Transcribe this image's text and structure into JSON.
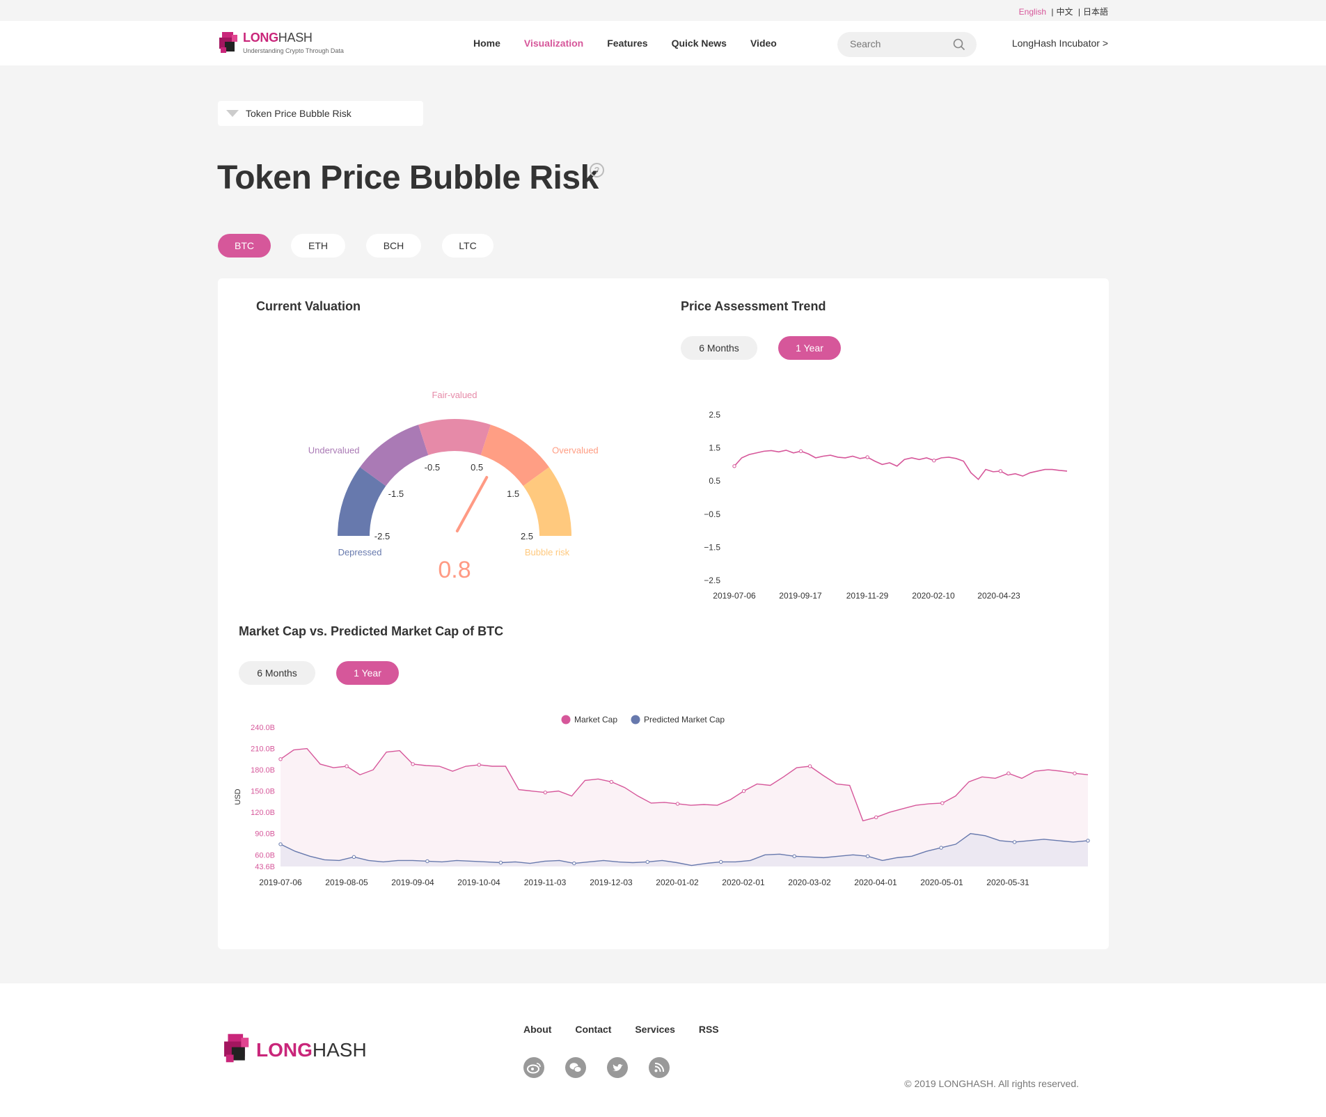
{
  "lang": {
    "english": "English",
    "chinese": "中文",
    "japanese": "日本語",
    "sep": "|"
  },
  "header": {
    "brand_long": "LONG",
    "brand_hash": "HASH",
    "tagline": "Understanding Crypto Through Data",
    "nav": [
      "Home",
      "Visualization",
      "Features",
      "Quick News",
      "Video"
    ],
    "nav_active": "Visualization",
    "search_placeholder": "Search",
    "incubator": "LongHash Incubator >"
  },
  "breadcrumb": {
    "value": "Token Price Bubble Risk"
  },
  "page": {
    "title": "Token Price Bubble Risk",
    "help": "?"
  },
  "coins": {
    "items": [
      "BTC",
      "ETH",
      "BCH",
      "LTC"
    ],
    "active": "BTC"
  },
  "valuation": {
    "title": "Current Valuation",
    "value": 0.8,
    "value_label": "0.8",
    "zones": [
      "Depressed",
      "Undervalued",
      "Fair-valued",
      "Overvalued",
      "Bubble risk"
    ],
    "ticks": [
      "-2.5",
      "-1.5",
      "-0.5",
      "0.5",
      "1.5",
      "2.5"
    ],
    "colors": {
      "depressed": "#6779ad",
      "undervalued": "#aa7ab5",
      "fair": "#e68aa8",
      "overvalued": "#ff9e84",
      "bubble": "#ffc97e",
      "needle": "#ff9a84"
    }
  },
  "trend": {
    "title": "Price Assessment Trend",
    "range_buttons": [
      "6 Months",
      "1 Year"
    ],
    "range_active": "1 Year"
  },
  "market_cap": {
    "title": "Market Cap vs. Predicted Market Cap of BTC",
    "range_buttons": [
      "6 Months",
      "1 Year"
    ],
    "range_active": "1 Year"
  },
  "chart_data": [
    {
      "type": "line",
      "title": "Price Assessment Trend",
      "xlabel": "",
      "ylabel": "",
      "x_ticks": [
        "2019-07-06",
        "2019-09-17",
        "2019-11-29",
        "2020-02-10",
        "2020-04-23"
      ],
      "y_ticks": [
        "2.5",
        "1.5",
        "0.5",
        "−0.5",
        "−1.5",
        "−2.5"
      ],
      "ylim": [
        -2.5,
        2.5
      ],
      "series": [
        {
          "color": "#d6579a",
          "values": [
            0.95,
            1.2,
            1.3,
            1.35,
            1.4,
            1.42,
            1.38,
            1.43,
            1.35,
            1.4,
            1.32,
            1.2,
            1.25,
            1.28,
            1.22,
            1.2,
            1.25,
            1.18,
            1.22,
            1.1,
            1.0,
            1.05,
            0.95,
            1.15,
            1.2,
            1.15,
            1.2,
            1.12,
            1.2,
            1.22,
            1.18,
            1.1,
            0.75,
            0.55,
            0.85,
            0.78,
            0.8,
            0.68,
            0.72,
            0.65,
            0.75,
            0.8,
            0.85,
            0.85,
            0.82,
            0.8
          ]
        }
      ]
    },
    {
      "type": "area",
      "title": "Market Cap vs. Predicted Market Cap of BTC",
      "xlabel": "",
      "ylabel": "USD",
      "x_ticks": [
        "2019-07-06",
        "2019-08-05",
        "2019-09-04",
        "2019-10-04",
        "2019-11-03",
        "2019-12-03",
        "2020-01-02",
        "2020-02-01",
        "2020-03-02",
        "2020-04-01",
        "2020-05-01",
        "2020-05-31"
      ],
      "y_ticks": [
        "240.0B",
        "210.0B",
        "180.0B",
        "150.0B",
        "120.0B",
        "90.0B",
        "60.0B",
        "43.6B"
      ],
      "ylim": [
        43.6,
        240.0
      ],
      "legend": "top-center",
      "series": [
        {
          "name": "Market Cap",
          "color": "#d6579a",
          "values": [
            195,
            208,
            210,
            188,
            183,
            185,
            173,
            180,
            205,
            207,
            188,
            186,
            185,
            178,
            185,
            187,
            185,
            185,
            152,
            150,
            148,
            150,
            143,
            165,
            167,
            163,
            155,
            143,
            133,
            134,
            132,
            130,
            131,
            130,
            138,
            150,
            160,
            158,
            170,
            183,
            185,
            172,
            160,
            158,
            108,
            113,
            120,
            125,
            130,
            132,
            133,
            143,
            163,
            170,
            168,
            175,
            168,
            178,
            180,
            178,
            175,
            173
          ]
        },
        {
          "name": "Predicted Market Cap",
          "color": "#6779ad",
          "values": [
            75,
            65,
            58,
            53,
            52,
            57,
            52,
            50,
            52,
            52,
            51,
            50,
            52,
            51,
            50,
            49,
            50,
            48,
            51,
            52,
            48,
            50,
            52,
            50,
            49,
            50,
            52,
            49,
            45,
            48,
            50,
            50,
            52,
            60,
            61,
            58,
            57,
            56,
            58,
            60,
            58,
            52,
            56,
            58,
            65,
            70,
            75,
            90,
            87,
            80,
            78,
            80,
            82,
            80,
            78,
            80
          ]
        }
      ]
    }
  ],
  "footer": {
    "brand_long": "LONG",
    "brand_hash": "HASH",
    "links": [
      "About",
      "Contact",
      "Services",
      "RSS"
    ],
    "social": [
      "weibo-icon",
      "wechat-icon",
      "twitter-icon",
      "rss-icon"
    ],
    "copyright": "© 2019 LONGHASH. All rights reserved."
  },
  "colors": {
    "accent": "#d6579a",
    "brand": "#c9267a"
  }
}
